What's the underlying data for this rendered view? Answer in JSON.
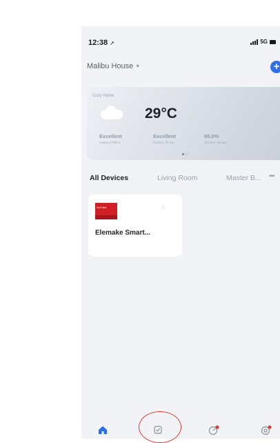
{
  "status_bar": {
    "time": "12:38",
    "network": "5G"
  },
  "header": {
    "home_name": "Malibu House",
    "add_label": "+"
  },
  "weather": {
    "card_label": "Cozy Home",
    "temperature": "29°C",
    "stats": [
      {
        "value": "Excellent",
        "label": "Outdoor PM2.5"
      },
      {
        "value": "Excellent",
        "label": "Outdoor Air Qu..."
      },
      {
        "value": "65.0%",
        "label": "Outdoor Humidi..."
      }
    ]
  },
  "tabs": [
    {
      "label": "All Devices",
      "active": true
    },
    {
      "label": "Living Room",
      "active": false
    },
    {
      "label": "Master B...",
      "active": false
    }
  ],
  "device": {
    "name": "Elemake Smart...",
    "logo_text": "GoTuba"
  },
  "bottom_nav": [
    "home-icon",
    "scene-icon",
    "smart-icon",
    "me-icon"
  ],
  "colors": {
    "accent": "#2e6fe8",
    "highlight": "#e53935",
    "notification": "#e53935"
  }
}
